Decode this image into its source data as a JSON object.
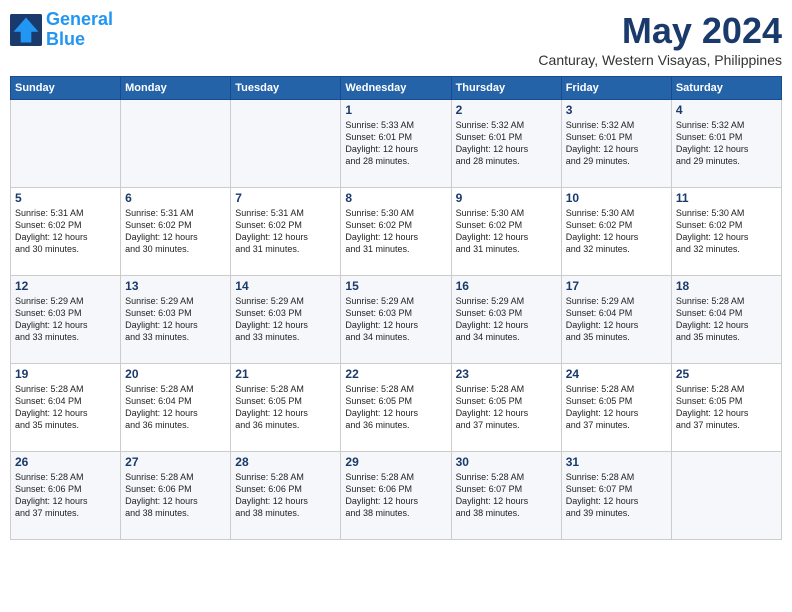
{
  "header": {
    "logo_line1": "General",
    "logo_line2": "Blue",
    "month": "May 2024",
    "location": "Canturay, Western Visayas, Philippines"
  },
  "days_of_week": [
    "Sunday",
    "Monday",
    "Tuesday",
    "Wednesday",
    "Thursday",
    "Friday",
    "Saturday"
  ],
  "weeks": [
    [
      {
        "day": "",
        "info": ""
      },
      {
        "day": "",
        "info": ""
      },
      {
        "day": "",
        "info": ""
      },
      {
        "day": "1",
        "info": "Sunrise: 5:33 AM\nSunset: 6:01 PM\nDaylight: 12 hours\nand 28 minutes."
      },
      {
        "day": "2",
        "info": "Sunrise: 5:32 AM\nSunset: 6:01 PM\nDaylight: 12 hours\nand 28 minutes."
      },
      {
        "day": "3",
        "info": "Sunrise: 5:32 AM\nSunset: 6:01 PM\nDaylight: 12 hours\nand 29 minutes."
      },
      {
        "day": "4",
        "info": "Sunrise: 5:32 AM\nSunset: 6:01 PM\nDaylight: 12 hours\nand 29 minutes."
      }
    ],
    [
      {
        "day": "5",
        "info": "Sunrise: 5:31 AM\nSunset: 6:02 PM\nDaylight: 12 hours\nand 30 minutes."
      },
      {
        "day": "6",
        "info": "Sunrise: 5:31 AM\nSunset: 6:02 PM\nDaylight: 12 hours\nand 30 minutes."
      },
      {
        "day": "7",
        "info": "Sunrise: 5:31 AM\nSunset: 6:02 PM\nDaylight: 12 hours\nand 31 minutes."
      },
      {
        "day": "8",
        "info": "Sunrise: 5:30 AM\nSunset: 6:02 PM\nDaylight: 12 hours\nand 31 minutes."
      },
      {
        "day": "9",
        "info": "Sunrise: 5:30 AM\nSunset: 6:02 PM\nDaylight: 12 hours\nand 31 minutes."
      },
      {
        "day": "10",
        "info": "Sunrise: 5:30 AM\nSunset: 6:02 PM\nDaylight: 12 hours\nand 32 minutes."
      },
      {
        "day": "11",
        "info": "Sunrise: 5:30 AM\nSunset: 6:02 PM\nDaylight: 12 hours\nand 32 minutes."
      }
    ],
    [
      {
        "day": "12",
        "info": "Sunrise: 5:29 AM\nSunset: 6:03 PM\nDaylight: 12 hours\nand 33 minutes."
      },
      {
        "day": "13",
        "info": "Sunrise: 5:29 AM\nSunset: 6:03 PM\nDaylight: 12 hours\nand 33 minutes."
      },
      {
        "day": "14",
        "info": "Sunrise: 5:29 AM\nSunset: 6:03 PM\nDaylight: 12 hours\nand 33 minutes."
      },
      {
        "day": "15",
        "info": "Sunrise: 5:29 AM\nSunset: 6:03 PM\nDaylight: 12 hours\nand 34 minutes."
      },
      {
        "day": "16",
        "info": "Sunrise: 5:29 AM\nSunset: 6:03 PM\nDaylight: 12 hours\nand 34 minutes."
      },
      {
        "day": "17",
        "info": "Sunrise: 5:29 AM\nSunset: 6:04 PM\nDaylight: 12 hours\nand 35 minutes."
      },
      {
        "day": "18",
        "info": "Sunrise: 5:28 AM\nSunset: 6:04 PM\nDaylight: 12 hours\nand 35 minutes."
      }
    ],
    [
      {
        "day": "19",
        "info": "Sunrise: 5:28 AM\nSunset: 6:04 PM\nDaylight: 12 hours\nand 35 minutes."
      },
      {
        "day": "20",
        "info": "Sunrise: 5:28 AM\nSunset: 6:04 PM\nDaylight: 12 hours\nand 36 minutes."
      },
      {
        "day": "21",
        "info": "Sunrise: 5:28 AM\nSunset: 6:05 PM\nDaylight: 12 hours\nand 36 minutes."
      },
      {
        "day": "22",
        "info": "Sunrise: 5:28 AM\nSunset: 6:05 PM\nDaylight: 12 hours\nand 36 minutes."
      },
      {
        "day": "23",
        "info": "Sunrise: 5:28 AM\nSunset: 6:05 PM\nDaylight: 12 hours\nand 37 minutes."
      },
      {
        "day": "24",
        "info": "Sunrise: 5:28 AM\nSunset: 6:05 PM\nDaylight: 12 hours\nand 37 minutes."
      },
      {
        "day": "25",
        "info": "Sunrise: 5:28 AM\nSunset: 6:05 PM\nDaylight: 12 hours\nand 37 minutes."
      }
    ],
    [
      {
        "day": "26",
        "info": "Sunrise: 5:28 AM\nSunset: 6:06 PM\nDaylight: 12 hours\nand 37 minutes."
      },
      {
        "day": "27",
        "info": "Sunrise: 5:28 AM\nSunset: 6:06 PM\nDaylight: 12 hours\nand 38 minutes."
      },
      {
        "day": "28",
        "info": "Sunrise: 5:28 AM\nSunset: 6:06 PM\nDaylight: 12 hours\nand 38 minutes."
      },
      {
        "day": "29",
        "info": "Sunrise: 5:28 AM\nSunset: 6:06 PM\nDaylight: 12 hours\nand 38 minutes."
      },
      {
        "day": "30",
        "info": "Sunrise: 5:28 AM\nSunset: 6:07 PM\nDaylight: 12 hours\nand 38 minutes."
      },
      {
        "day": "31",
        "info": "Sunrise: 5:28 AM\nSunset: 6:07 PM\nDaylight: 12 hours\nand 39 minutes."
      },
      {
        "day": "",
        "info": ""
      }
    ]
  ]
}
